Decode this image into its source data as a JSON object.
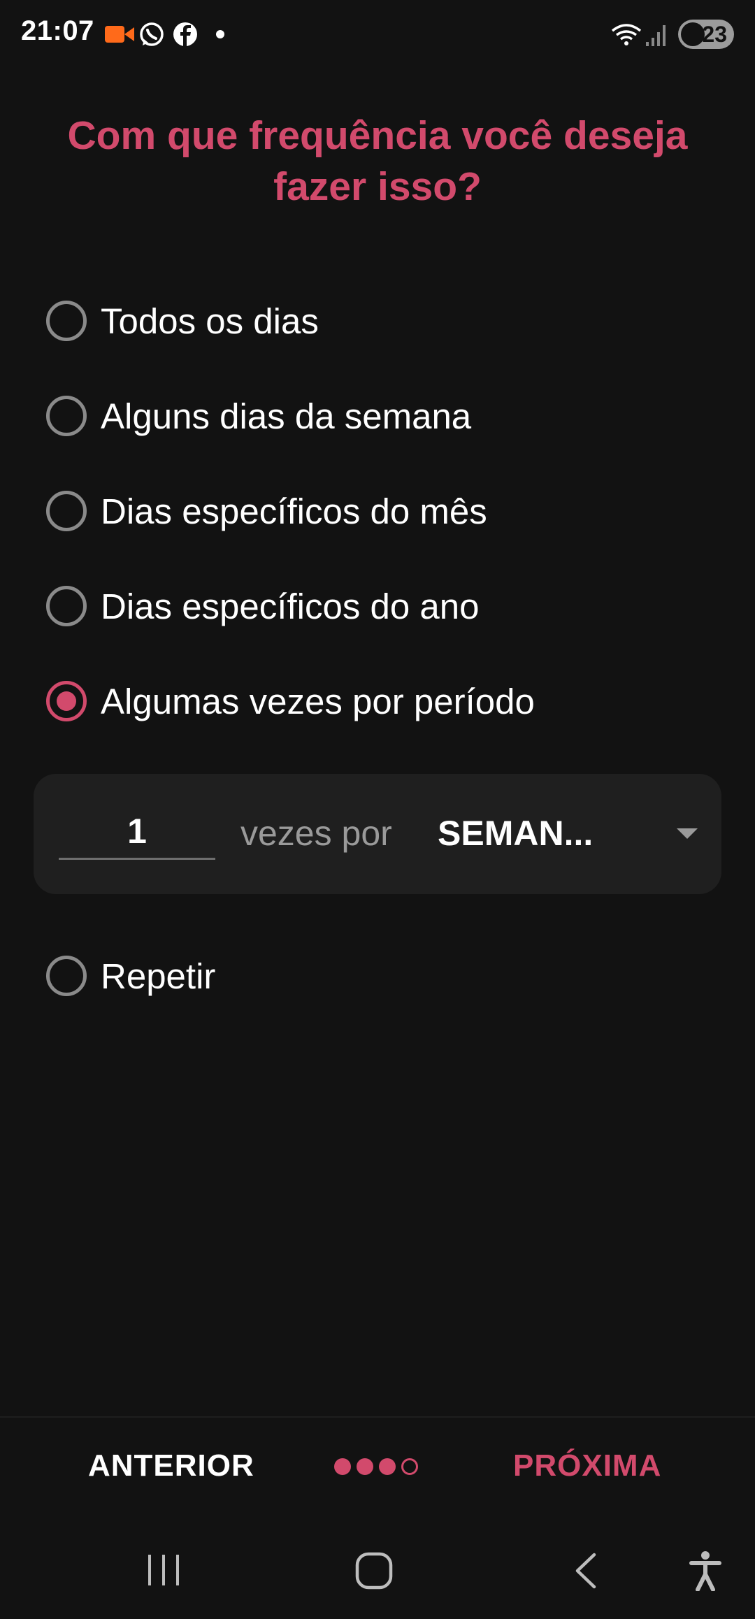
{
  "status_bar": {
    "time": "21:07",
    "battery": "23",
    "icons": [
      "video-call-icon",
      "whatsapp-icon",
      "facebook-icon",
      "notification-dot-icon",
      "wifi-icon",
      "signal-icon",
      "battery-icon"
    ]
  },
  "screen": {
    "title": "Com que frequência você deseja fazer isso?"
  },
  "options": [
    {
      "label": "Todos os dias",
      "selected": false
    },
    {
      "label": "Alguns dias da semana",
      "selected": false
    },
    {
      "label": "Dias específicos do mês",
      "selected": false
    },
    {
      "label": "Dias específicos do ano",
      "selected": false
    },
    {
      "label": "Algumas vezes por período",
      "selected": true
    },
    {
      "label": "Repetir",
      "selected": false
    }
  ],
  "frequency": {
    "count": "1",
    "times_per_label": "vezes por",
    "period_value": "SEMAN..."
  },
  "footer": {
    "prev_label": "ANTERIOR",
    "next_label": "PRÓXIMA",
    "steps_total": 4,
    "steps_filled": 3
  },
  "colors": {
    "accent": "#d24a6c",
    "background": "#121212",
    "card": "#1f1f1f"
  }
}
